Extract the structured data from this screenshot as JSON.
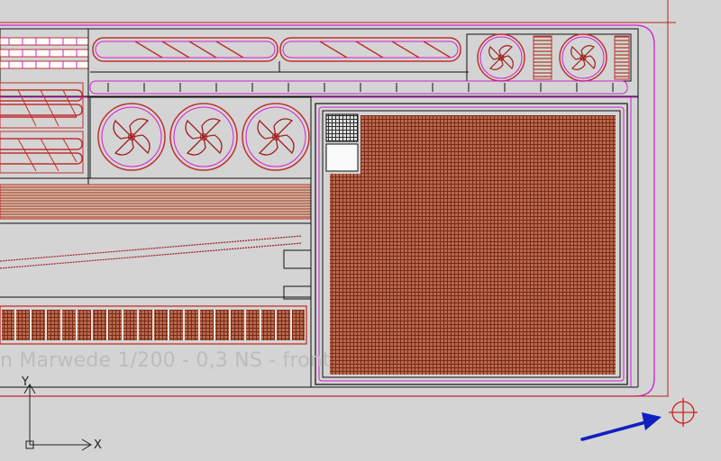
{
  "viewport": {
    "background": "#d4d4d4",
    "watermark_text": "n Marwede 1/200 - 0,3 NS - front"
  },
  "ucs": {
    "x_label": "X",
    "y_label": "Y"
  },
  "colors": {
    "outline": "#111111",
    "magenta": "#d020d0",
    "red": "#c02020",
    "brown": "#8a3a20",
    "arrow": "#1020c0"
  },
  "icons": {
    "crosshair": "target-crosshair-icon",
    "pointer": "blue-arrow-pointer"
  }
}
